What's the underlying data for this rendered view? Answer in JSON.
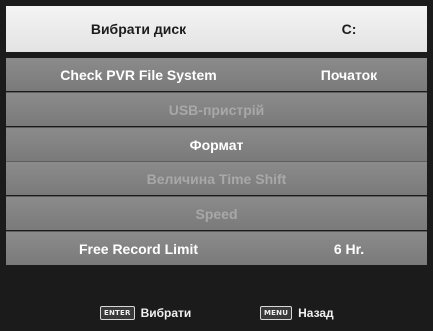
{
  "menu": {
    "header": {
      "label": "Вибрати диск",
      "value": "C:"
    },
    "items": [
      {
        "label": "Check PVR File System",
        "value": "Початок",
        "enabled": true
      },
      {
        "label": "USB-пристрій",
        "enabled": false
      },
      {
        "label": "Формат",
        "enabled": true
      },
      {
        "label": "Величина Time Shift",
        "enabled": false
      },
      {
        "label": "Speed",
        "enabled": false
      },
      {
        "label": "Free Record Limit",
        "value": "6 Hr.",
        "enabled": true
      }
    ]
  },
  "footer": {
    "enter": {
      "key": "ENTER",
      "label": "Вибрати"
    },
    "menu": {
      "key": "MENU",
      "label": "Назад"
    }
  },
  "colors": {
    "header_bg": "#eeeeee",
    "item_bg": "#838383",
    "footer_bg": "#1b1b1b",
    "text_enabled": "#ffffff",
    "text_disabled": "#a8a8a8"
  }
}
